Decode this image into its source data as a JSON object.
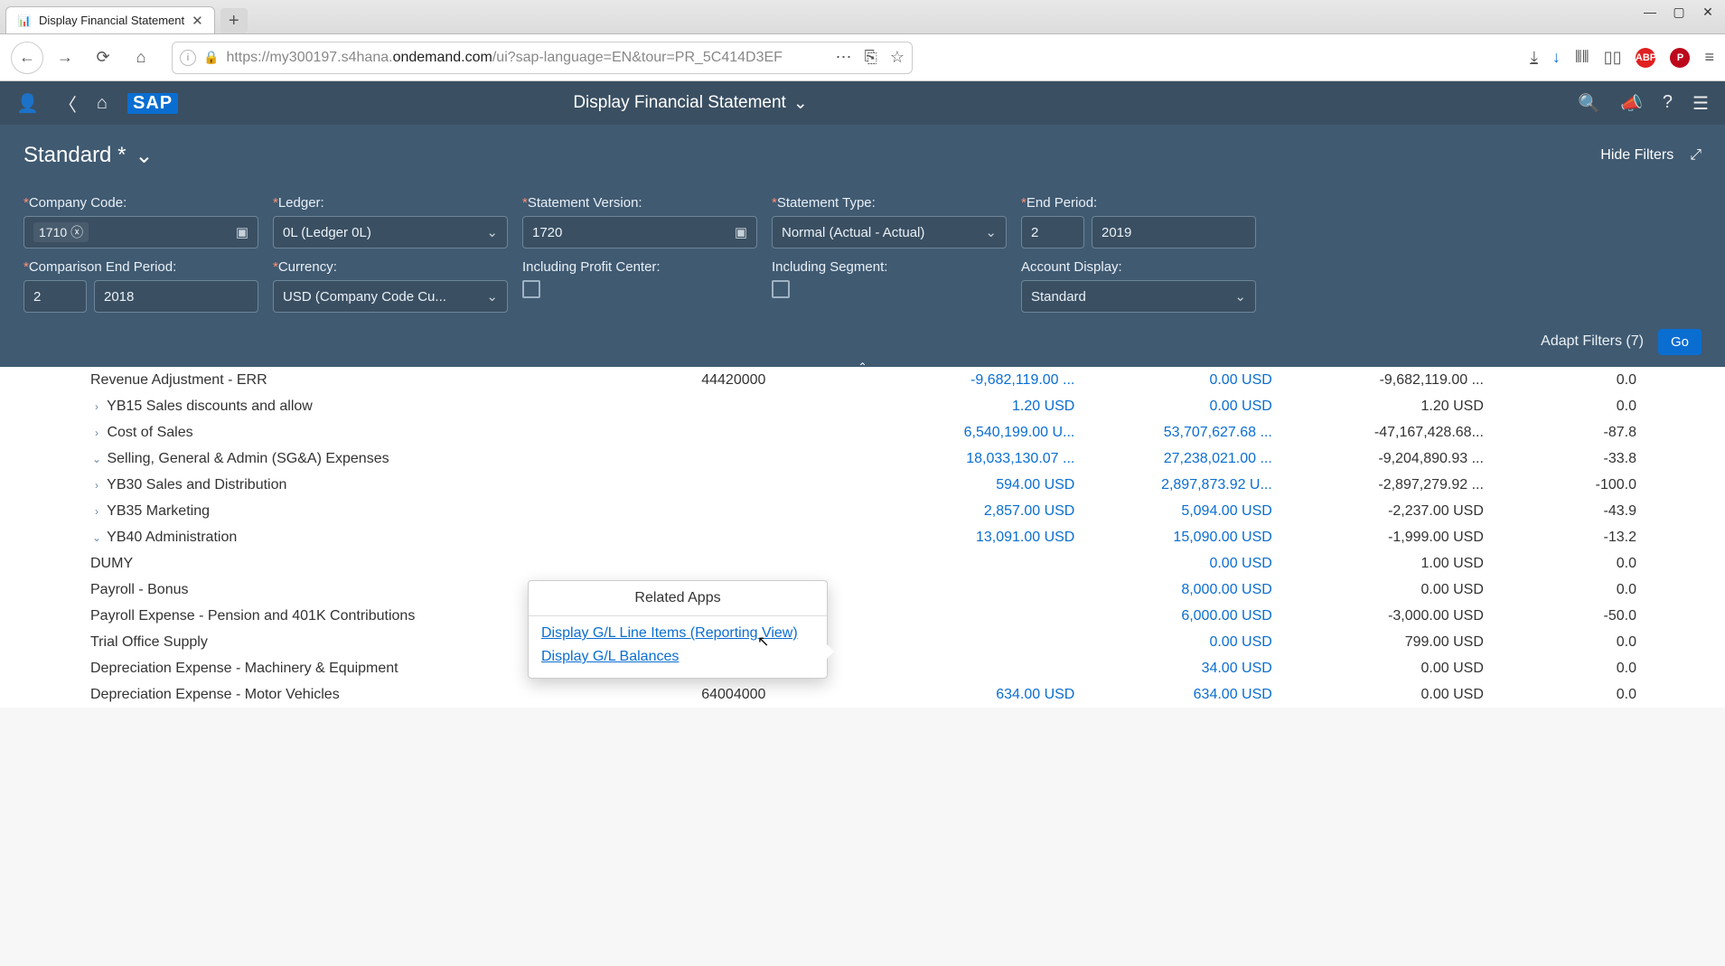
{
  "browser": {
    "tab_title": "Display Financial Statement",
    "url_prefix": "https://my300197.s4hana.",
    "url_domain": "ondemand.com",
    "url_suffix": "/ui?sap-language=EN&tour=PR_5C414D3EF"
  },
  "shell": {
    "title": "Display Financial Statement"
  },
  "variant": "Standard *",
  "hide_filters": "Hide Filters",
  "adapt_filters": "Adapt Filters (7)",
  "go": "Go",
  "filters": {
    "company_code": {
      "label": "Company Code:",
      "value": "1710"
    },
    "ledger": {
      "label": "Ledger:",
      "value": "0L (Ledger 0L)"
    },
    "stmt_version": {
      "label": "Statement Version:",
      "value": "1720"
    },
    "stmt_type": {
      "label": "Statement Type:",
      "value": "Normal (Actual - Actual)"
    },
    "end_period": {
      "label": "End Period:",
      "p": "2",
      "y": "2019"
    },
    "comp_end_period": {
      "label": "Comparison End Period:",
      "p": "2",
      "y": "2018"
    },
    "currency": {
      "label": "Currency:",
      "value": "USD (Company Code Cu..."
    },
    "inc_profit_center": {
      "label": "Including Profit Center:"
    },
    "inc_segment": {
      "label": "Including Segment:"
    },
    "acct_display": {
      "label": "Account Display:",
      "value": "Standard"
    }
  },
  "rows": [
    {
      "ind": 4,
      "exp": "",
      "desc": "Revenue Adjustment - ERR",
      "acct": "44420000",
      "pb": "-9,682,119.00 ...",
      "cb": "0.00 USD",
      "abs": "-9,682,119.00 ...",
      "rel": "0.0"
    },
    {
      "ind": 3,
      "exp": ">",
      "desc": "YB15 Sales discounts and allow",
      "acct": "",
      "pb": "1.20 USD",
      "cb": "0.00 USD",
      "abs": "1.20 USD",
      "rel": "0.0"
    },
    {
      "ind": 2,
      "exp": ">",
      "desc": "Cost of Sales",
      "acct": "",
      "pb": "6,540,199.00 U...",
      "cb": "53,707,627.68 ...",
      "abs": "-47,167,428.68...",
      "rel": "-87.8"
    },
    {
      "ind": 2,
      "exp": "v",
      "desc": "Selling, General & Admin (SG&A) Expenses",
      "acct": "",
      "pb": "18,033,130.07 ...",
      "cb": "27,238,021.00 ...",
      "abs": "-9,204,890.93 ...",
      "rel": "-33.8"
    },
    {
      "ind": 3,
      "exp": ">",
      "desc": "YB30 Sales and Distribution",
      "acct": "",
      "pb": "594.00 USD",
      "cb": "2,897,873.92 U...",
      "abs": "-2,897,279.92 ...",
      "rel": "-100.0"
    },
    {
      "ind": 3,
      "exp": ">",
      "desc": "YB35 Marketing",
      "acct": "",
      "pb": "2,857.00 USD",
      "cb": "5,094.00 USD",
      "abs": "-2,237.00 USD",
      "rel": "-43.9"
    },
    {
      "ind": 3,
      "exp": "v",
      "desc": "YB40 Administration",
      "acct": "",
      "pb": "13,091.00 USD",
      "cb": "15,090.00 USD",
      "abs": "-1,999.00 USD",
      "rel": "-13.2"
    },
    {
      "ind": 4,
      "exp": "",
      "desc": "DUMY",
      "acct": "",
      "pb": "",
      "cb": "0.00 USD",
      "abs": "1.00 USD",
      "rel": "0.0"
    },
    {
      "ind": 4,
      "exp": "",
      "desc": "Payroll - Bonus",
      "acct": "",
      "pb": "",
      "cb": "8,000.00 USD",
      "abs": "0.00 USD",
      "rel": "0.0"
    },
    {
      "ind": 4,
      "exp": "",
      "desc": "Payroll Expense - Pension and 401K Contributions",
      "acct": "",
      "pb": "",
      "cb": "6,000.00 USD",
      "abs": "-3,000.00 USD",
      "rel": "-50.0"
    },
    {
      "ind": 4,
      "exp": "",
      "desc": "Trial Office Supply",
      "acct": "",
      "pb": "",
      "cb": "0.00 USD",
      "abs": "799.00 USD",
      "rel": "0.0"
    },
    {
      "ind": 4,
      "exp": "",
      "desc": "Depreciation Expense - Machinery & Equipment",
      "acct": "",
      "pb": "",
      "cb": "34.00 USD",
      "abs": "0.00 USD",
      "rel": "0.0"
    },
    {
      "ind": 4,
      "exp": "",
      "desc": "Depreciation Expense - Motor Vehicles",
      "acct": "64004000",
      "pb": "634.00 USD",
      "cb": "634.00 USD",
      "abs": "0.00 USD",
      "rel": "0.0"
    }
  ],
  "popover": {
    "title": "Related Apps",
    "link1": "Display G/L Line Items (Reporting View)",
    "link2": "Display G/L Balances"
  }
}
